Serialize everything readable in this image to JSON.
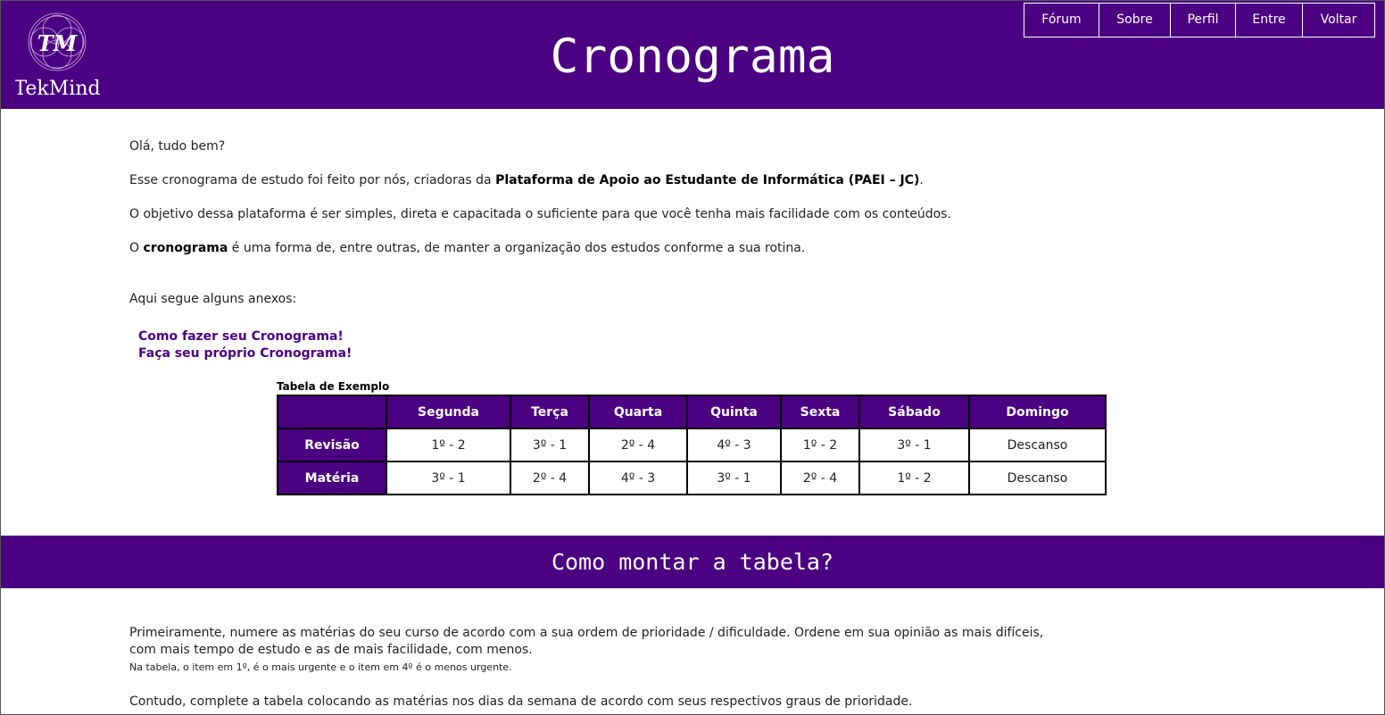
{
  "header": {
    "logo_initials": "TM",
    "logo_name": "TekMind",
    "title": "Cronograma",
    "nav": [
      "Fórum",
      "Sobre",
      "Perfil",
      "Entre",
      "Voltar"
    ]
  },
  "intro": {
    "greeting": "Olá, tudo bem?",
    "p2_before": "Esse cronograma de estudo foi feito por nós, criadoras da ",
    "p2_bold": "Plataforma de Apoio ao Estudante de Informática (PAEI – JC)",
    "p2_after": ".",
    "p3": "O objetivo dessa plataforma é ser simples, direta e capacitada o suficiente para que você tenha mais facilidade com os conteúdos.",
    "p4_before": "O ",
    "p4_bold": "cronograma",
    "p4_after": " é uma forma de, entre outras, de manter a organização dos estudos conforme a sua rotina.",
    "annex_label": "Aqui segue alguns anexos:",
    "links": [
      "Como fazer seu Cronograma!",
      "Faça seu próprio Cronograma!"
    ]
  },
  "table": {
    "caption": "Tabela de Exemplo",
    "columns": [
      "",
      "Segunda",
      "Terça",
      "Quarta",
      "Quinta",
      "Sexta",
      "Sábado",
      "Domingo"
    ],
    "rows": [
      {
        "label": "Revisão",
        "cells": [
          "1º - 2",
          "3º - 1",
          "2º - 4",
          "4º - 3",
          "1º - 2",
          "3º - 1",
          "Descanso"
        ]
      },
      {
        "label": "Matéria",
        "cells": [
          "3º - 1",
          "2º - 4",
          "4º - 3",
          "3º - 1",
          "2º - 4",
          "1º - 2",
          "Descanso"
        ]
      }
    ]
  },
  "section": {
    "title": "Como montar a tabela?",
    "p1_line1": "Primeiramente, numere as matérias do seu curso de acordo com a sua ordem de prioridade / dificuldade. Ordene em sua opinião as mais difíceis,",
    "p1_line2": "com mais tempo de estudo e as de mais facilidade, com menos.",
    "p1_note": "Na tabela, o item em 1º, é o mais urgente e o item em 4º é o menos urgente.",
    "p2": "Contudo, complete a tabela colocando as matérias nos dias da semana de acordo com seus respectivos graus de prioridade."
  },
  "colors": {
    "brand": "#4b0082",
    "text": "#222222",
    "header_text": "#ffffff"
  }
}
